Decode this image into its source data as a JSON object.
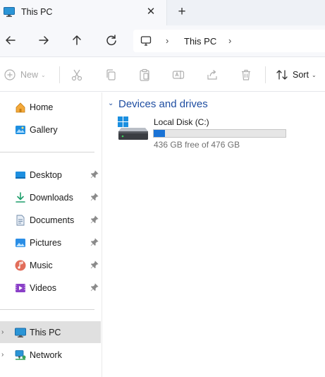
{
  "tab": {
    "title": "This PC",
    "close_glyph": "✕",
    "new_tab_glyph": "+",
    "icon": "monitor-icon"
  },
  "address": {
    "chevron": "›",
    "crumb": "This PC"
  },
  "toolbar": {
    "new_label": "New",
    "sort_label": "Sort",
    "caret": "⌄"
  },
  "sidebar": {
    "quick": [
      {
        "label": "Home",
        "icon": "home-icon"
      },
      {
        "label": "Gallery",
        "icon": "gallery-icon"
      }
    ],
    "pinned": [
      {
        "label": "Desktop",
        "icon": "desktop-folder-icon"
      },
      {
        "label": "Downloads",
        "icon": "downloads-folder-icon"
      },
      {
        "label": "Documents",
        "icon": "documents-folder-icon"
      },
      {
        "label": "Pictures",
        "icon": "pictures-folder-icon"
      },
      {
        "label": "Music",
        "icon": "music-folder-icon"
      },
      {
        "label": "Videos",
        "icon": "videos-folder-icon"
      }
    ],
    "locations": [
      {
        "label": "This PC",
        "icon": "this-pc-icon",
        "selected": true
      },
      {
        "label": "Network",
        "icon": "network-icon",
        "selected": false
      }
    ],
    "expand_glyph": "›"
  },
  "content": {
    "group_title": "Devices and drives",
    "group_chevron": "⌄",
    "drives": [
      {
        "name": "Local Disk (C:)",
        "free_text": "436 GB free of 476 GB",
        "used_fraction": 0.084
      }
    ]
  },
  "colors": {
    "accent": "#1e4da1",
    "usage_bar": "#1a73d6",
    "selected_bg": "#e0e0e0"
  }
}
